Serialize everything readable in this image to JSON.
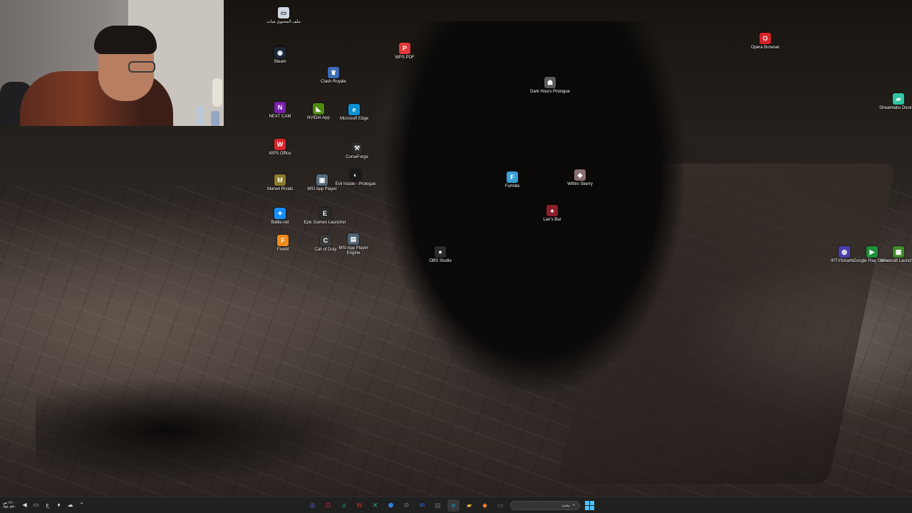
{
  "desktop": {
    "icons": [
      {
        "id": "arabic-file",
        "label": "ملف المحتوى شات",
        "glyph": "▭",
        "color": "#cfd7e3",
        "fg": "#333333"
      },
      {
        "id": "steam",
        "label": "Steam",
        "glyph": "◉",
        "color": "#1b2838"
      },
      {
        "id": "nextcam",
        "label": "NEXT CAM",
        "glyph": "N",
        "color": "#7a1fb0"
      },
      {
        "id": "wps-office",
        "label": "WPS Office",
        "glyph": "W",
        "color": "#d9232a"
      },
      {
        "id": "marvel-rivals",
        "label": "Marvel Rivals",
        "glyph": "M",
        "color": "#8a7a2a"
      },
      {
        "id": "battlenet",
        "label": "Battle.net",
        "glyph": "✦",
        "color": "#148eff"
      },
      {
        "id": "fivem",
        "label": "FiveM",
        "glyph": "F",
        "color": "#f28a1b"
      },
      {
        "id": "nvidia-app",
        "label": "NVIDIA App",
        "glyph": "◣",
        "color": "#4f8a10"
      },
      {
        "id": "msi-app-player",
        "label": "MSI App Player",
        "glyph": "▣",
        "color": "#556b7d"
      },
      {
        "id": "epic-games",
        "label": "Epic Games Launcher",
        "glyph": "E",
        "color": "#2a2a2a"
      },
      {
        "id": "call-of-duty",
        "label": "Call of Duty",
        "glyph": "C",
        "color": "#3a3a3a"
      },
      {
        "id": "clash-royale",
        "label": "Clash Royale",
        "glyph": "♛",
        "color": "#3b6bb5"
      },
      {
        "id": "microsoft-edge",
        "label": "Microsoft Edge",
        "glyph": "e",
        "color": "#0c8fd3"
      },
      {
        "id": "curseforge",
        "label": "CurseForge",
        "glyph": "⚒",
        "color": "#2b2b2b"
      },
      {
        "id": "evil-inside",
        "label": "Evil Inside - Prologue",
        "glyph": "◐",
        "color": "#1a1a1a"
      },
      {
        "id": "msi-player-engine",
        "label": "MSI App Player Engine",
        "glyph": "▤",
        "color": "#4f6273"
      },
      {
        "id": "wps-pdf",
        "label": "WPS PDF",
        "glyph": "P",
        "color": "#e0383a"
      },
      {
        "id": "obs-studio",
        "label": "OBS Studio",
        "glyph": "●",
        "color": "#2b2b2b"
      },
      {
        "id": "fortnite",
        "label": "Fortnite",
        "glyph": "F",
        "color": "#3aa0d8"
      },
      {
        "id": "dark-hours",
        "label": "Dark Hours Prologue",
        "glyph": "☗",
        "color": "#5b5b5b"
      },
      {
        "id": "within-skerry",
        "label": "Within Skerry",
        "glyph": "◆",
        "color": "#8a6d70"
      },
      {
        "id": "liars-bar",
        "label": "Liar's Bar",
        "glyph": "♠",
        "color": "#8a1e2a"
      },
      {
        "id": "opera-browser",
        "label": "Opera Browser",
        "glyph": "O",
        "color": "#d9232a"
      },
      {
        "id": "streamlabs",
        "label": "Streamlabs Desktop",
        "glyph": "▰",
        "color": "#31c3a2"
      },
      {
        "id": "iptv-smarters",
        "label": "IPTVSmarte...",
        "glyph": "◍",
        "color": "#4b3fb0"
      },
      {
        "id": "google-play-games",
        "label": "Google Play Games",
        "glyph": "▶",
        "color": "#1d8f3c"
      },
      {
        "id": "minecraft-launcher",
        "label": "Minecraft Launcher",
        "glyph": "▦",
        "color": "#3f8a2b"
      }
    ]
  },
  "taskbar": {
    "clock_time": "١٢:٠٠ ص",
    "clock_date": "٢٥/٠٧/٢٠",
    "tray_lang": "ع",
    "search_placeholder": "بحث",
    "apps": [
      {
        "id": "chrome",
        "glyph": "◎",
        "color": "#5f6fd8"
      },
      {
        "id": "opera",
        "glyph": "O",
        "color": "#d9232a"
      },
      {
        "id": "spotify",
        "glyph": "♫",
        "color": "#1ed760"
      },
      {
        "id": "wps",
        "glyph": "W",
        "color": "#d9232a"
      },
      {
        "id": "capcut",
        "glyph": "✕",
        "color": "#2fae7a"
      },
      {
        "id": "shield",
        "glyph": "⬢",
        "color": "#3a7bd5"
      },
      {
        "id": "settings",
        "glyph": "⚙",
        "color": "#6c6c6c"
      },
      {
        "id": "mail",
        "glyph": "✉",
        "color": "#2b6cd0"
      },
      {
        "id": "store",
        "glyph": "▤",
        "color": "#6c6c6c"
      },
      {
        "id": "edge",
        "glyph": "e",
        "color": "#1fa2e0",
        "active": true
      },
      {
        "id": "file-explorer",
        "glyph": "▰",
        "color": "#e8b43a"
      },
      {
        "id": "photos",
        "glyph": "◆",
        "color": "#f07d2a"
      },
      {
        "id": "task-view",
        "glyph": "▭",
        "color": "#6c6c6c"
      }
    ]
  }
}
